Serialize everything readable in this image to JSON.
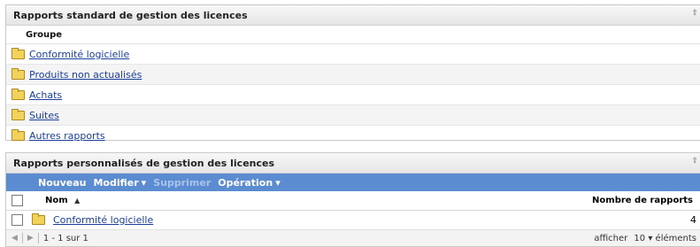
{
  "standard": {
    "title": "Rapports standard de gestion des licences",
    "column": "Groupe",
    "items": [
      {
        "label": "Conformité logicielle"
      },
      {
        "label": "Produits non actualisés"
      },
      {
        "label": "Achats"
      },
      {
        "label": "Suites"
      },
      {
        "label": "Autres rapports"
      }
    ]
  },
  "custom": {
    "title": "Rapports personnalisés de gestion des licences",
    "toolbar": {
      "new": "Nouveau",
      "modify": "Modifier",
      "delete": "Supprimer",
      "operation": "Opération",
      "dropdown_glyph": "▾"
    },
    "columns": {
      "name": "Nom",
      "sort_glyph": "▲",
      "count": "Nombre de rapports"
    },
    "rows": [
      {
        "name": "Conformité logicielle",
        "count": "4"
      }
    ],
    "pager": {
      "range": "1 - 1 sur 1",
      "show_label": "afficher",
      "per_page": "10",
      "items_label": "éléments"
    }
  },
  "icons": {
    "folder": "folder-icon",
    "collapse": "collapse-icon",
    "prev": "prev-page-icon",
    "next": "next-page-icon"
  },
  "colors": {
    "toolbar_bg": "#5b8bd1",
    "link": "#1a3e9a",
    "folder": "#f3d25c"
  }
}
